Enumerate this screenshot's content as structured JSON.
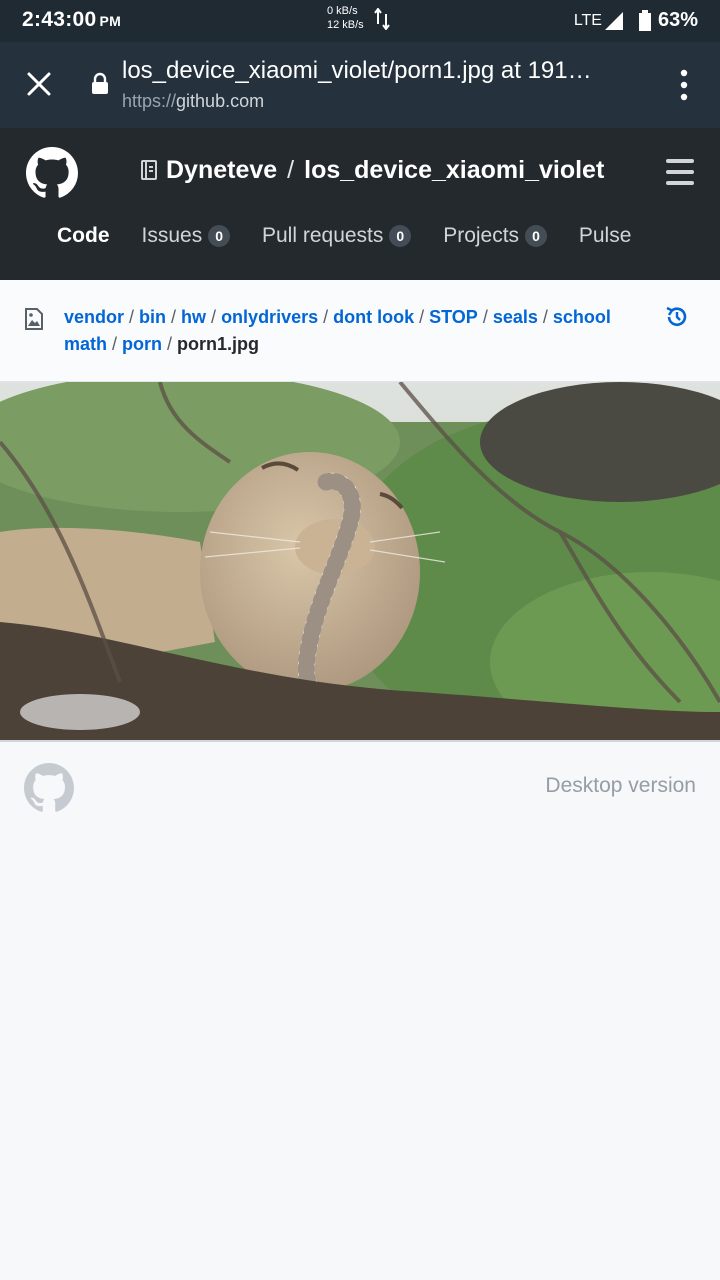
{
  "status_bar": {
    "time": "2:43:00",
    "ampm": "PM",
    "speed_down": "0 kB/s",
    "speed_up": "12 kB/s",
    "network": "LTE",
    "battery": "63%"
  },
  "browser": {
    "page_title": "los_device_xiaomi_violet/porn1.jpg at 191…",
    "url_scheme": "https://",
    "url_domain": "github.com"
  },
  "repo": {
    "owner": "Dyneteve",
    "separator": "/",
    "name": "los_device_xiaomi_violet"
  },
  "nav": {
    "code": "Code",
    "issues": "Issues",
    "issues_count": "0",
    "pull_requests": "Pull requests",
    "pull_requests_count": "0",
    "projects": "Projects",
    "projects_count": "0",
    "pulse": "Pulse"
  },
  "breadcrumb": {
    "items": [
      "vendor",
      "bin",
      "hw",
      "onlydrivers",
      "dont look",
      "STOP",
      "seals",
      "school",
      "math",
      "porn"
    ],
    "separator": "/",
    "file": "porn1.jpg"
  },
  "footer": {
    "desktop_link": "Desktop version"
  },
  "colors": {
    "status_bar_bg": "#1f2a33",
    "tab_bar_bg": "#25323d",
    "header_bg": "#24292e",
    "link": "#0366d6"
  }
}
